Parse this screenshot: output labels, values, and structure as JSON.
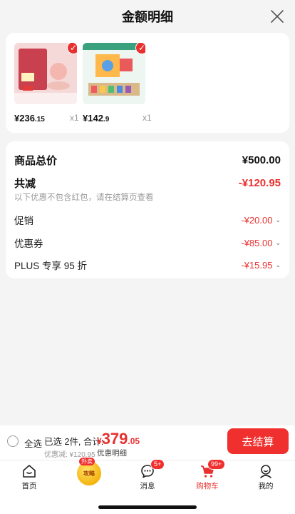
{
  "header": {
    "title": "金额明细"
  },
  "products": [
    {
      "price_int": "¥236",
      "price_dec": ".15",
      "qty": "x1"
    },
    {
      "price_int": "¥142",
      "price_dec": ".9",
      "qty": "x1"
    }
  ],
  "summary": {
    "total_label": "商品总价",
    "total_value": "¥500.00",
    "reduce_label": "共减",
    "reduce_value": "-¥120.95",
    "note": "以下优惠不包含红包，请在结算页查看",
    "items": [
      {
        "label": "促销",
        "value": "-¥20.00"
      },
      {
        "label": "优惠券",
        "value": "-¥85.00"
      },
      {
        "label": "PLUS 专享 95 折",
        "value": "-¥15.95"
      }
    ]
  },
  "checkout": {
    "select_all": "全选",
    "selected_text": "已选 2件, 合计:",
    "amount_cur": "¥",
    "amount_int": "379",
    "amount_dec": ".05",
    "discount_text": "优惠减: ¥120.95",
    "detail_link": "优惠明细",
    "pay_button": "去结算"
  },
  "promo": {
    "tag": "外卖",
    "text": "攻略"
  },
  "tabs": [
    {
      "label": "首页"
    },
    {
      "label": "消息",
      "badge": "5+"
    },
    {
      "label": "购物车",
      "badge": "99+"
    },
    {
      "label": "我的"
    }
  ],
  "colors": {
    "accent": "#e8312f",
    "background": "#f4f4f4"
  }
}
